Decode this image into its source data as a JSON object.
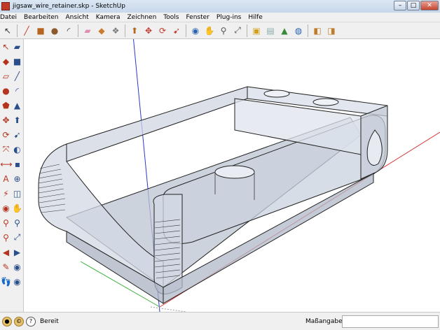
{
  "window": {
    "title": "jigsaw_wire_retainer.skp - SketchUp"
  },
  "menu": [
    "Datei",
    "Bearbeiten",
    "Ansicht",
    "Kamera",
    "Zeichnen",
    "Tools",
    "Fenster",
    "Plug-ins",
    "Hilfe"
  ],
  "window_buttons": {
    "minimize": "–",
    "maximize": "□",
    "close": "✕"
  },
  "toolbar_icons": [
    {
      "name": "select-icon",
      "glyph": "↖",
      "color": "#333"
    },
    {
      "name": "line-icon",
      "glyph": "╱",
      "color": "#c0392b"
    },
    {
      "name": "rectangle-icon",
      "glyph": "■",
      "color": "#b5651d"
    },
    {
      "name": "circle-icon",
      "glyph": "●",
      "color": "#8b5a2b"
    },
    {
      "name": "arc-icon",
      "glyph": "◜",
      "color": "#333"
    },
    {
      "name": "eraser-icon",
      "glyph": "▰",
      "color": "#e08fb0"
    },
    {
      "name": "paint-bucket-icon",
      "glyph": "◆",
      "color": "#c87c2c"
    },
    {
      "name": "make-component-icon",
      "glyph": "❖",
      "color": "#7a7a7a"
    },
    {
      "name": "push-pull-icon",
      "glyph": "⬆",
      "color": "#b5651d"
    },
    {
      "name": "move-icon",
      "glyph": "✥",
      "color": "#c0392b"
    },
    {
      "name": "rotate-icon",
      "glyph": "⟳",
      "color": "#c0392b"
    },
    {
      "name": "follow-me-icon",
      "glyph": "➹",
      "color": "#c0392b"
    },
    {
      "name": "orbit-icon",
      "glyph": "◉",
      "color": "#2a63b0"
    },
    {
      "name": "pan-icon",
      "glyph": "✋",
      "color": "#555"
    },
    {
      "name": "zoom-icon",
      "glyph": "⚲",
      "color": "#555"
    },
    {
      "name": "zoom-extents-icon",
      "glyph": "⤢",
      "color": "#555"
    },
    {
      "name": "get-models-icon",
      "glyph": "▣",
      "color": "#d4a017"
    },
    {
      "name": "share-model-icon",
      "glyph": "▤",
      "color": "#8aa"
    },
    {
      "name": "place-model-icon",
      "glyph": "▲",
      "color": "#3a8a3a"
    },
    {
      "name": "preview-google-earth-icon",
      "glyph": "◍",
      "color": "#2a63b0"
    },
    {
      "name": "component-browser-icon",
      "glyph": "◧",
      "color": "#c07a2a"
    },
    {
      "name": "extension-warehouse-icon",
      "glyph": "◨",
      "color": "#c07a2a"
    }
  ],
  "left_tools": [
    [
      "↖",
      "▰"
    ],
    [
      "◆",
      "■"
    ],
    [
      "▱",
      "╱"
    ],
    [
      "●",
      "◜"
    ],
    [
      "⬟",
      "▲"
    ],
    [
      "✥",
      "⬆"
    ],
    [
      "⟳",
      "➹"
    ],
    [
      "⤧",
      "◐"
    ],
    [
      "⟷",
      "▪"
    ],
    [
      "A",
      "⊕"
    ],
    [
      "⚡",
      "◫"
    ],
    [
      "◉",
      "✋"
    ],
    [
      "⚲",
      "⚲"
    ],
    [
      "⚲",
      "⤢"
    ],
    [
      "◀",
      "▶"
    ],
    [
      "✎",
      "◉"
    ],
    [
      "👣",
      "◉"
    ]
  ],
  "status": {
    "text": "Bereit",
    "vcb_label": "Maßangaben",
    "vcb_value": ""
  },
  "colors": {
    "axis_red": "#d43a3a",
    "axis_green": "#3ab03a",
    "axis_blue": "#2a3acb",
    "model_face": "#c9d1de"
  }
}
